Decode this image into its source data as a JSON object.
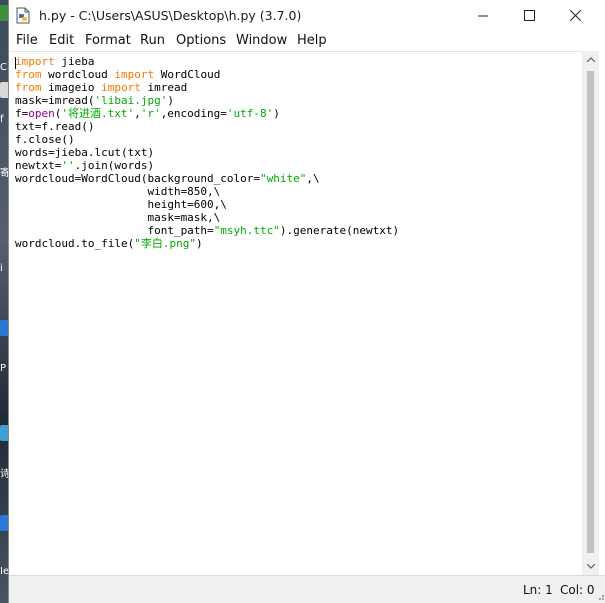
{
  "window": {
    "title": "h.py - C:\\Users\\ASUS\\Desktop\\h.py (3.7.0)"
  },
  "menu": [
    "File",
    "Edit",
    "Format",
    "Run",
    "Options",
    "Window",
    "Help"
  ],
  "code": [
    [
      {
        "t": "import",
        "c": "kw"
      },
      {
        "t": " jieba",
        "c": ""
      }
    ],
    [
      {
        "t": "from",
        "c": "kw"
      },
      {
        "t": " wordcloud ",
        "c": ""
      },
      {
        "t": "import",
        "c": "kw"
      },
      {
        "t": " WordCloud",
        "c": ""
      }
    ],
    [
      {
        "t": "from",
        "c": "kw"
      },
      {
        "t": " imageio ",
        "c": ""
      },
      {
        "t": "import",
        "c": "kw"
      },
      {
        "t": " imread",
        "c": ""
      }
    ],
    [
      {
        "t": "mask=imread(",
        "c": ""
      },
      {
        "t": "'libai.jpg'",
        "c": "str"
      },
      {
        "t": ")",
        "c": ""
      }
    ],
    [
      {
        "t": "f=",
        "c": ""
      },
      {
        "t": "open",
        "c": "bi"
      },
      {
        "t": "(",
        "c": ""
      },
      {
        "t": "'将进酒.txt'",
        "c": "str"
      },
      {
        "t": ",",
        "c": ""
      },
      {
        "t": "'r'",
        "c": "str"
      },
      {
        "t": ",encoding=",
        "c": ""
      },
      {
        "t": "'utf-8'",
        "c": "str"
      },
      {
        "t": ")",
        "c": ""
      }
    ],
    [
      {
        "t": "txt=f.read()",
        "c": ""
      }
    ],
    [
      {
        "t": "f.close()",
        "c": ""
      }
    ],
    [
      {
        "t": "words=jieba.lcut(txt)",
        "c": ""
      }
    ],
    [
      {
        "t": "newtxt=",
        "c": ""
      },
      {
        "t": "''",
        "c": "str"
      },
      {
        "t": ".join(words)",
        "c": ""
      }
    ],
    [
      {
        "t": "wordcloud=WordCloud(background_color=",
        "c": ""
      },
      {
        "t": "\"white\"",
        "c": "str"
      },
      {
        "t": ",\\",
        "c": ""
      }
    ],
    [
      {
        "t": "                    width=850,\\",
        "c": ""
      }
    ],
    [
      {
        "t": "                    height=600,\\",
        "c": ""
      }
    ],
    [
      {
        "t": "                    mask=mask,\\",
        "c": ""
      }
    ],
    [
      {
        "t": "                    font_path=",
        "c": ""
      },
      {
        "t": "\"msyh.ttc\"",
        "c": "str"
      },
      {
        "t": ").generate(newtxt)",
        "c": ""
      }
    ],
    [
      {
        "t": "wordcloud.to_file(",
        "c": ""
      },
      {
        "t": "\"李白.png\"",
        "c": "str"
      },
      {
        "t": ")",
        "c": ""
      }
    ]
  ],
  "status": {
    "line": "Ln: 1",
    "col": "Col: 0"
  },
  "desktop_text": [
    "C",
    "f",
    "寄",
    "i",
    "P",
    "1",
    "诗",
    "Ie"
  ],
  "colors": {
    "keyword": "#ff7700",
    "builtin": "#900090",
    "string": "#00aa00",
    "background": "#ffffff"
  }
}
